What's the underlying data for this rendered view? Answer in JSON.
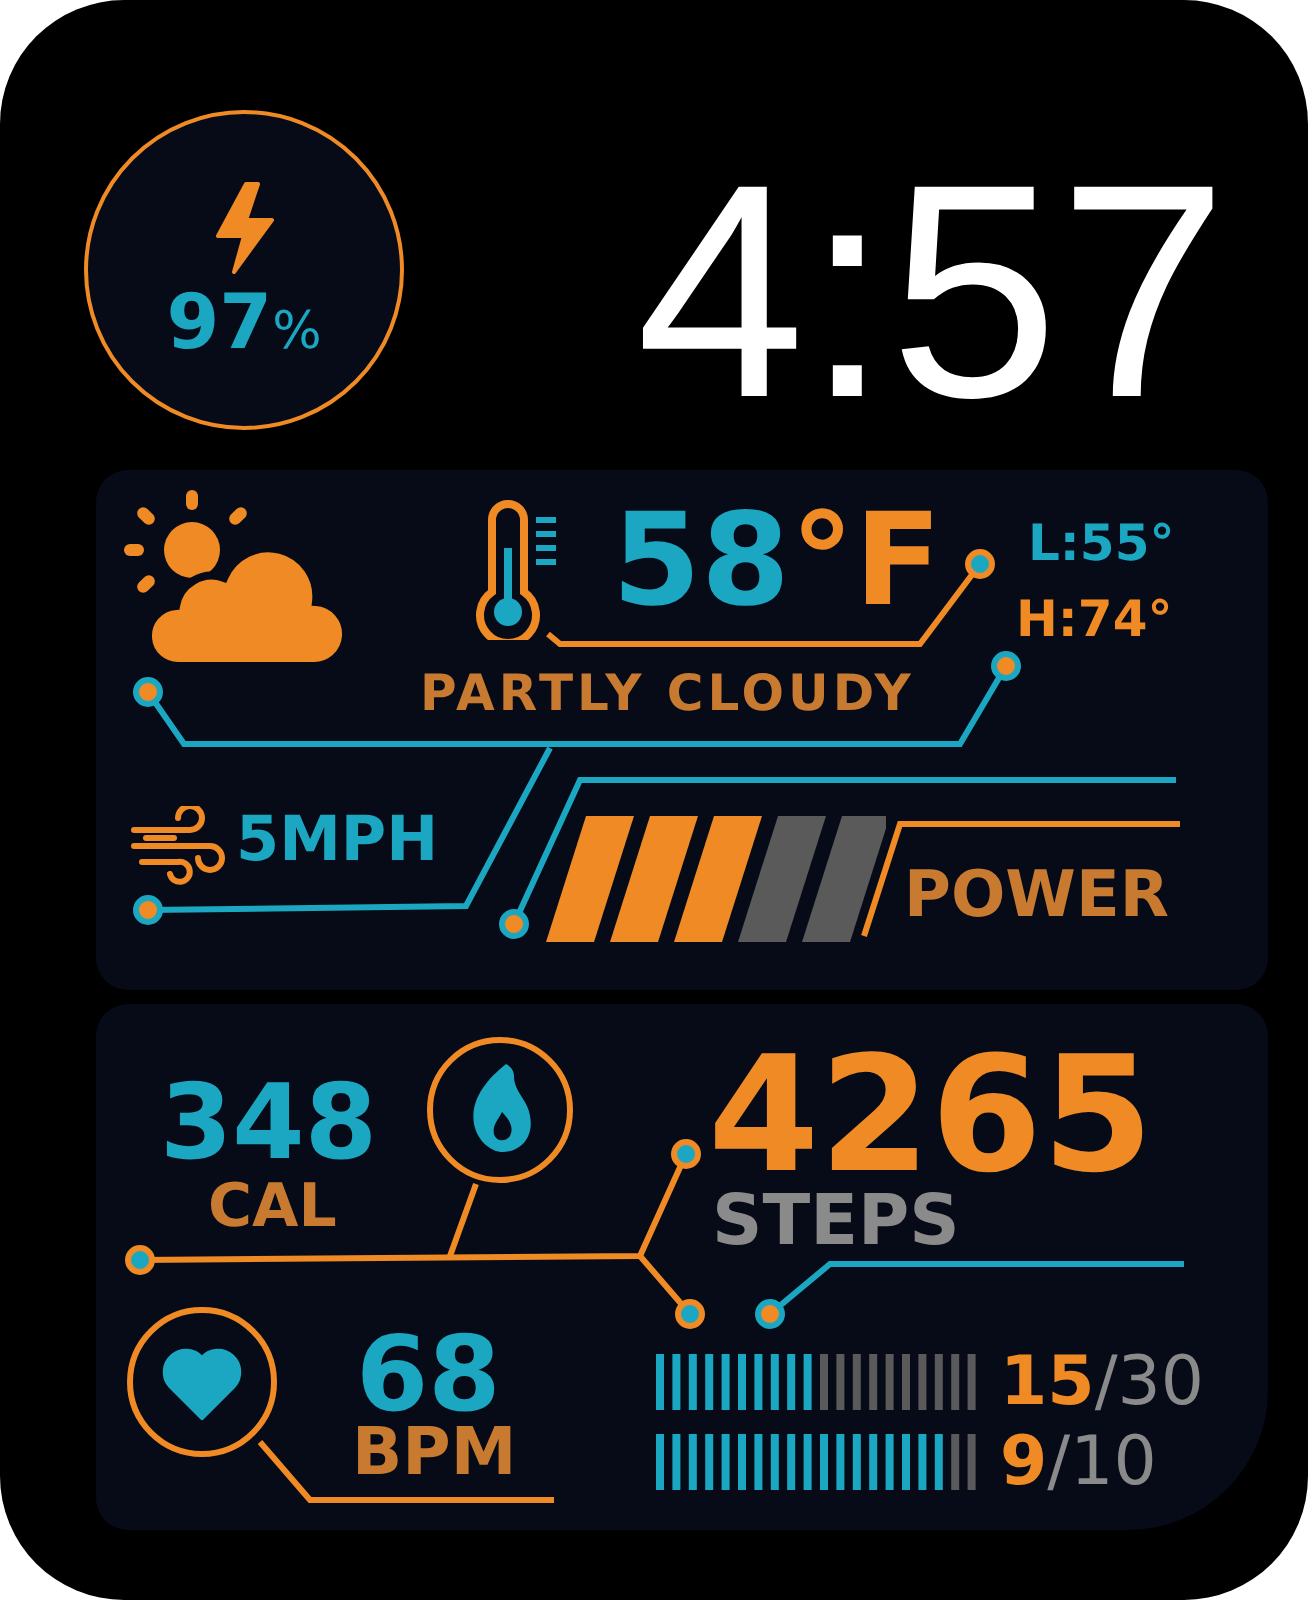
{
  "time": "4:57",
  "battery": {
    "value": "97",
    "unit": "%"
  },
  "weather": {
    "temperature": "58",
    "unit": "°F",
    "low": "L:55°",
    "high": "H:74°",
    "condition": "PARTLY CLOUDY",
    "wind": "5MPH",
    "power": {
      "label": "POWER",
      "level": 0.6
    }
  },
  "activity": {
    "calories": "348",
    "calories_unit": "CAL",
    "steps": "4265",
    "steps_label": "STEPS",
    "heart_rate": "68",
    "heart_rate_unit": "BPM",
    "goals": [
      {
        "current": "15",
        "total": "/30",
        "level": 0.5
      },
      {
        "current": "9",
        "total": "/10",
        "level": 0.9
      }
    ]
  }
}
